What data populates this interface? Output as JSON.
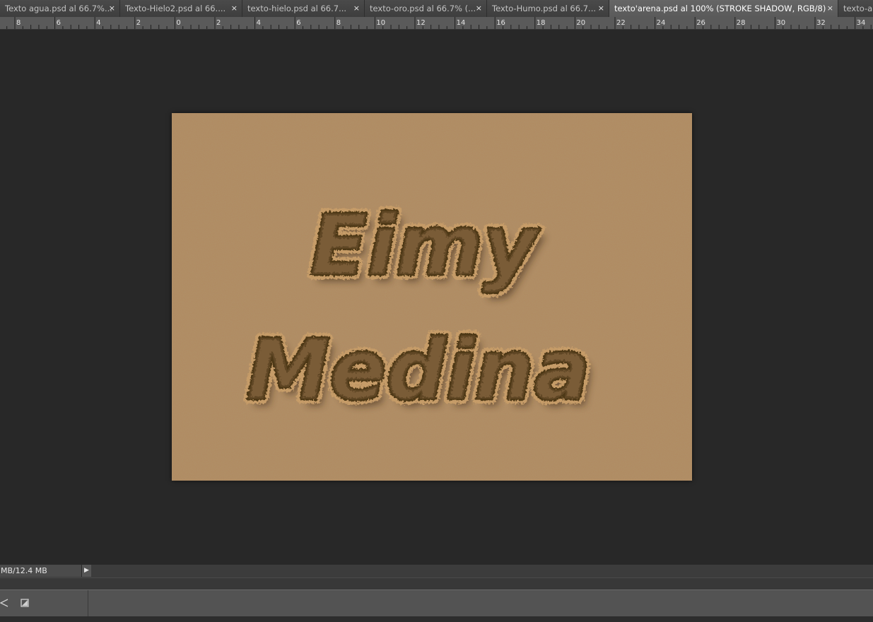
{
  "tabs": [
    {
      "label": "Texto agua.psd al 66.7%...",
      "close": "×",
      "active": false
    },
    {
      "label": "Texto-Hielo2.psd al 66....",
      "close": "×",
      "active": false
    },
    {
      "label": "texto-hielo.psd al 66.7...",
      "close": "×",
      "active": false
    },
    {
      "label": "texto-oro.psd al 66.7% (...",
      "close": "×",
      "active": false
    },
    {
      "label": "Texto-Humo.psd al 66.7...",
      "close": "×",
      "active": false
    },
    {
      "label": "texto'arena.psd al 100% (STROKE SHADOW, RGB/8)",
      "close": "×",
      "active": true
    },
    {
      "label": "texto-a",
      "close": "",
      "active": false
    }
  ],
  "ruler": {
    "labels": [
      "8",
      "6",
      "4",
      "2",
      "0",
      "2",
      "4",
      "6",
      "8",
      "10",
      "12",
      "14",
      "16",
      "18",
      "20",
      "22",
      "24",
      "26",
      "28",
      "30",
      "32",
      "34"
    ]
  },
  "document": {
    "text_line1": "Eimy",
    "text_line2": "Medina",
    "sand_color": "#b08a60",
    "engrave_color": "#6e5230"
  },
  "status": {
    "doc_size": "MB/12.4 MB",
    "arrow": "▶"
  },
  "bottom_panel": {
    "icons": [
      "scissors-icon",
      "square-edit-icon"
    ]
  }
}
